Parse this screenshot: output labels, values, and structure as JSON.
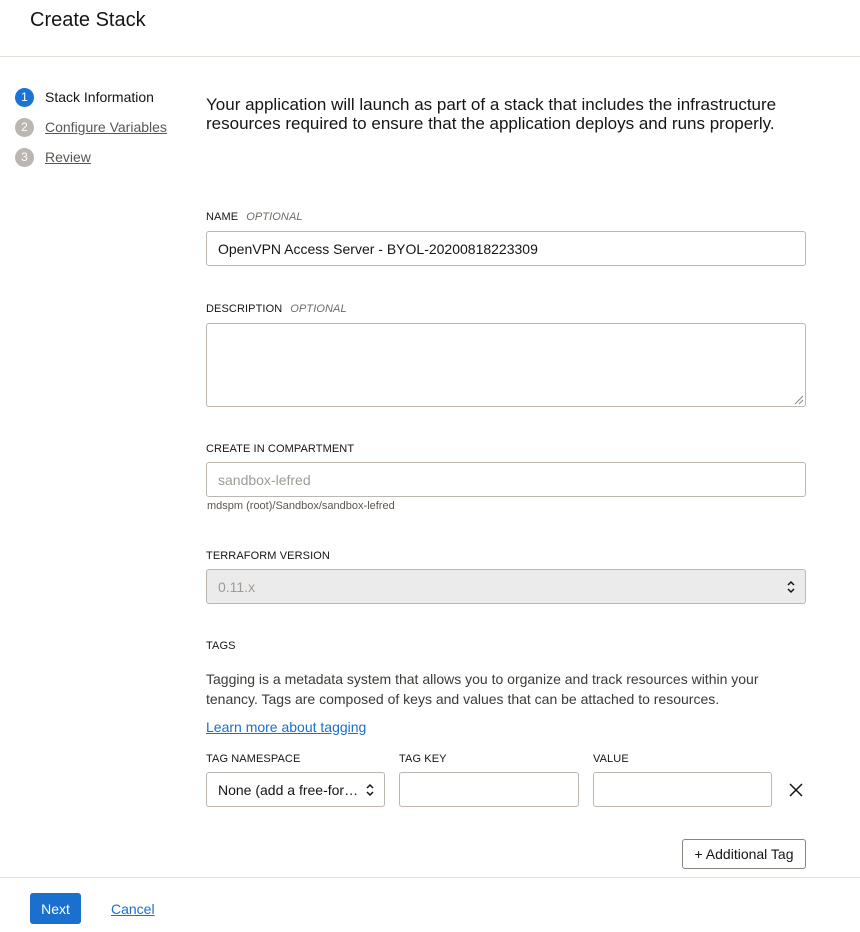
{
  "header": {
    "title": "Create Stack"
  },
  "steps": [
    {
      "number": "1",
      "label": "Stack Information",
      "active": true
    },
    {
      "number": "2",
      "label": "Configure Variables",
      "active": false
    },
    {
      "number": "3",
      "label": "Review",
      "active": false
    }
  ],
  "intro": "Your application will launch as part of a stack that includes the infrastructure resources required to ensure that the application deploys and runs properly.",
  "name_field": {
    "label": "NAME",
    "optional": "OPTIONAL",
    "value": "OpenVPN Access Server - BYOL-20200818223309"
  },
  "description_field": {
    "label": "DESCRIPTION",
    "optional": "OPTIONAL",
    "value": ""
  },
  "compartment": {
    "label": "CREATE IN COMPARTMENT",
    "value": "sandbox-lefred",
    "path": "mdspm (root)/Sandbox/sandbox-lefred"
  },
  "terraform": {
    "label": "TERRAFORM VERSION",
    "value": "0.11.x"
  },
  "tags": {
    "label": "TAGS",
    "description": "Tagging is a metadata system that allows you to organize and track resources within your tenancy. Tags are composed of keys and values that can be attached to resources.",
    "learn_more": "Learn more about tagging",
    "namespace_label": "TAG NAMESPACE",
    "namespace_value": "None (add a free-for…",
    "key_label": "TAG KEY",
    "key_value": "",
    "value_label": "VALUE",
    "value_value": "",
    "add_button": "+ Additional Tag"
  },
  "footer": {
    "next": "Next",
    "cancel": "Cancel"
  },
  "colors": {
    "primary": "#1a6fcf",
    "step_active": "#1a73d9",
    "step_inactive": "#bcb6b1"
  }
}
